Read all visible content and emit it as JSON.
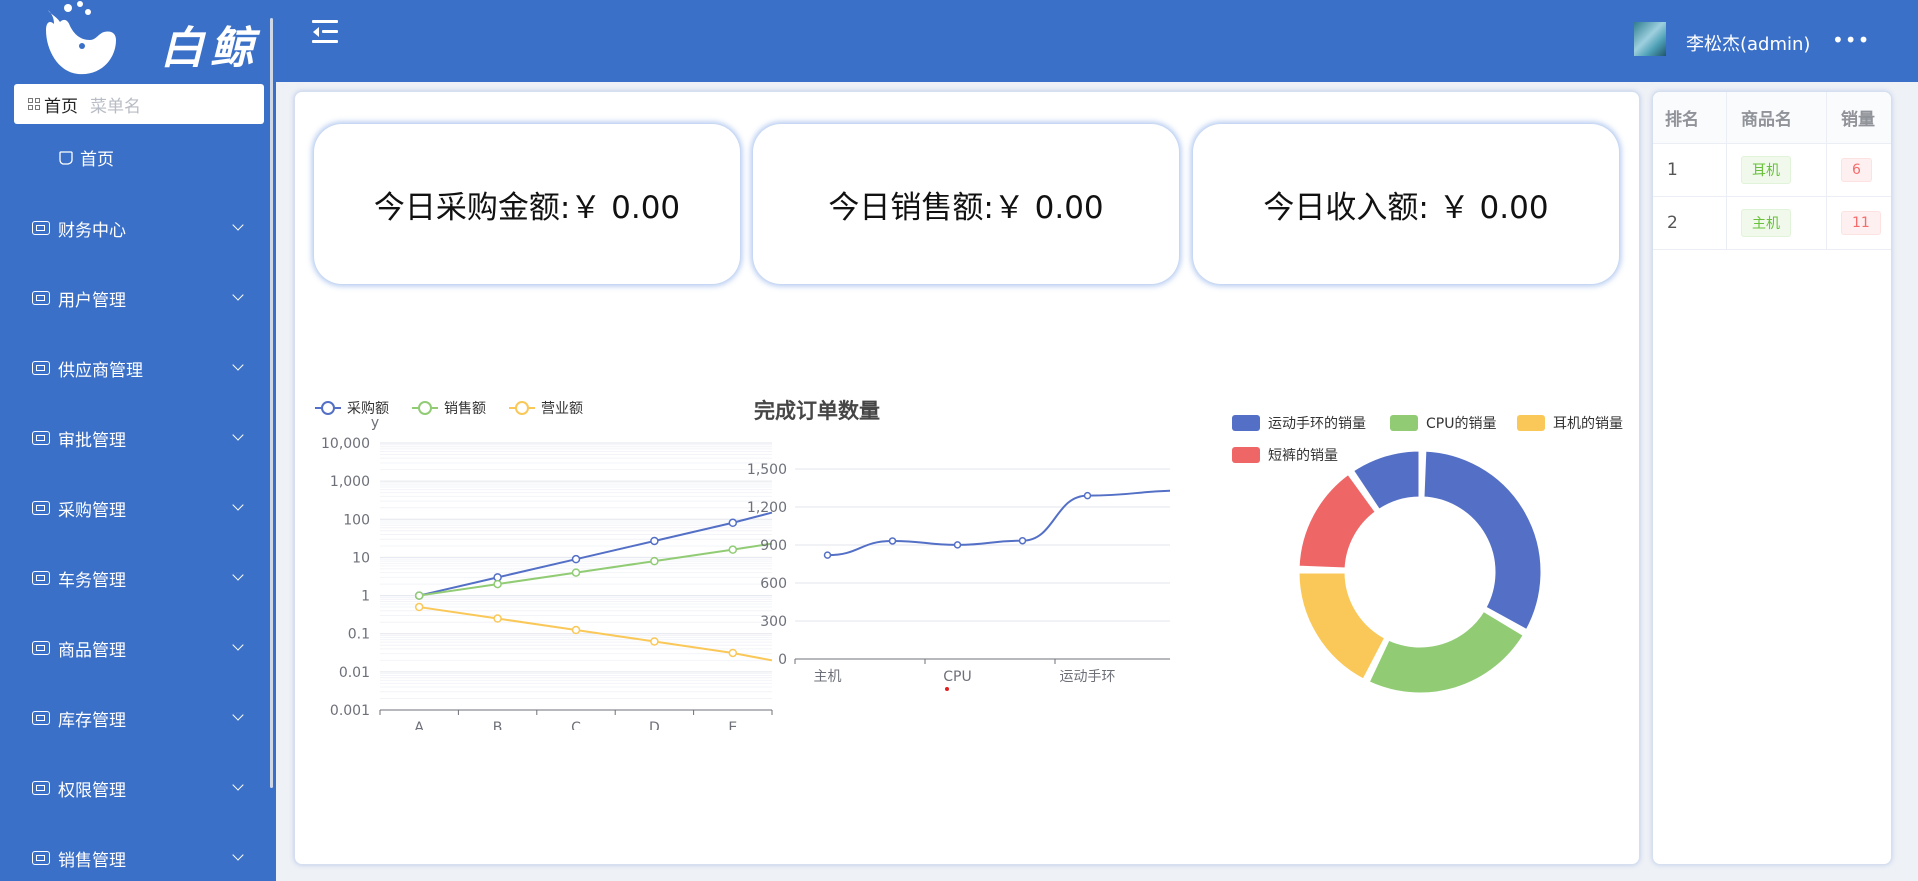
{
  "sidebar": {
    "logo_text": "白鲸",
    "crumb": "首页",
    "search_placeholder": "菜单名",
    "home_label": "首页",
    "items": [
      {
        "label": "财务中心"
      },
      {
        "label": "用户管理"
      },
      {
        "label": "供应商管理"
      },
      {
        "label": "审批管理"
      },
      {
        "label": "采购管理"
      },
      {
        "label": "车务管理"
      },
      {
        "label": "商品管理"
      },
      {
        "label": "库存管理"
      },
      {
        "label": "权限管理"
      },
      {
        "label": "销售管理"
      }
    ]
  },
  "header": {
    "username": "李松杰(admin)",
    "more": "•••"
  },
  "stats": [
    {
      "label": "今日采购金额:￥ 0.00"
    },
    {
      "label": "今日销售额:￥ 0.00"
    },
    {
      "label": "今日收入额: ￥ 0.00"
    }
  ],
  "ranking": {
    "headers": [
      "排名",
      "商品名",
      "销量"
    ],
    "rows": [
      {
        "rank": "1",
        "name": "耳机",
        "sales": "6"
      },
      {
        "rank": "2",
        "name": "主机",
        "sales": "11"
      }
    ]
  },
  "colors": {
    "blue": "#5470c6",
    "green": "#91cc75",
    "yellow": "#fac858",
    "red": "#ee6666",
    "brand": "#3b70c8"
  },
  "chart_data": [
    {
      "type": "line",
      "title": "",
      "xlabel": "",
      "ylabel": "y",
      "scale": "log",
      "categories": [
        "A",
        "B",
        "C",
        "D",
        "E"
      ],
      "yticks": [
        "0.001",
        "0.01",
        "0.1",
        "1",
        "10",
        "100",
        "1,000",
        "10,000"
      ],
      "legend_position": "top-left",
      "series": [
        {
          "name": "采购额",
          "values": [
            1,
            3,
            9,
            27,
            81,
            150
          ]
        },
        {
          "name": "销售额",
          "values": [
            1,
            2,
            4,
            8,
            16,
            23
          ]
        },
        {
          "name": "营业额",
          "values": [
            0.5,
            0.25,
            0.125,
            0.0625,
            0.03125,
            0.02
          ]
        }
      ]
    },
    {
      "type": "line",
      "title": "完成订单数量",
      "categories": [
        "主机",
        "",
        "CPU",
        "",
        "运动手环",
        ""
      ],
      "shown_categories": [
        "主机",
        "CPU",
        "运动手环"
      ],
      "yticks": [
        "0",
        "300",
        "600",
        "900",
        "1,200",
        "1,500"
      ],
      "ylim": [
        0,
        1500
      ],
      "smooth": true,
      "series": [
        {
          "values": [
            820,
            932,
            901,
            934,
            1290,
            1330
          ]
        }
      ]
    },
    {
      "type": "pie",
      "donut": true,
      "legend_position": "top",
      "slices": [
        {
          "name": "运动手环的销量",
          "value": 33
        },
        {
          "name": "CPU的销量",
          "value": 24
        },
        {
          "name": "耳机的销量",
          "value": 18
        },
        {
          "name": "短裤的销量",
          "value": 15
        },
        {
          "name": "",
          "value": 10
        }
      ]
    }
  ]
}
